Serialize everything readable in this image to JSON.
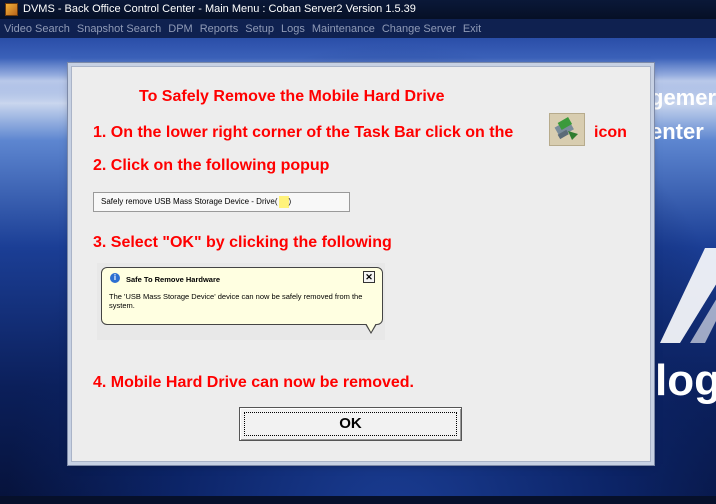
{
  "window": {
    "title": "DVMS - Back Office Control Center - Main Menu : Coban Server2 Version 1.5.39"
  },
  "menu": {
    "items": [
      "Video Search",
      "Snapshot Search",
      "DPM",
      "Reports",
      "Setup",
      "Logs",
      "Maintenance",
      "Change Server",
      "Exit"
    ]
  },
  "background": {
    "text_line1": "gemer",
    "text_line2": "enter",
    "text_line3": "log"
  },
  "dialog": {
    "title": "To Safely Remove the Mobile Hard Drive",
    "step1": "1. On the lower right corner of the Task Bar click on the",
    "step1_suffix": "icon",
    "step2": "2. Click on the following popup",
    "popup_label": "Safely remove USB Mass Storage Device - Drive(",
    "popup_label_end": ")",
    "step3": "3. Select \"OK\" by clicking the following",
    "balloon": {
      "title": "Safe To Remove Hardware",
      "message": "The 'USB Mass Storage Device' device can now be safely removed from the system.",
      "close_glyph": "✕",
      "info_glyph": "i"
    },
    "step4": "4. Mobile Hard Drive can now be removed.",
    "ok_label": "OK"
  },
  "colors": {
    "instruction_red": "#ff0000",
    "dialog_bg": "#ededed",
    "balloon_bg": "#ffffe1"
  }
}
